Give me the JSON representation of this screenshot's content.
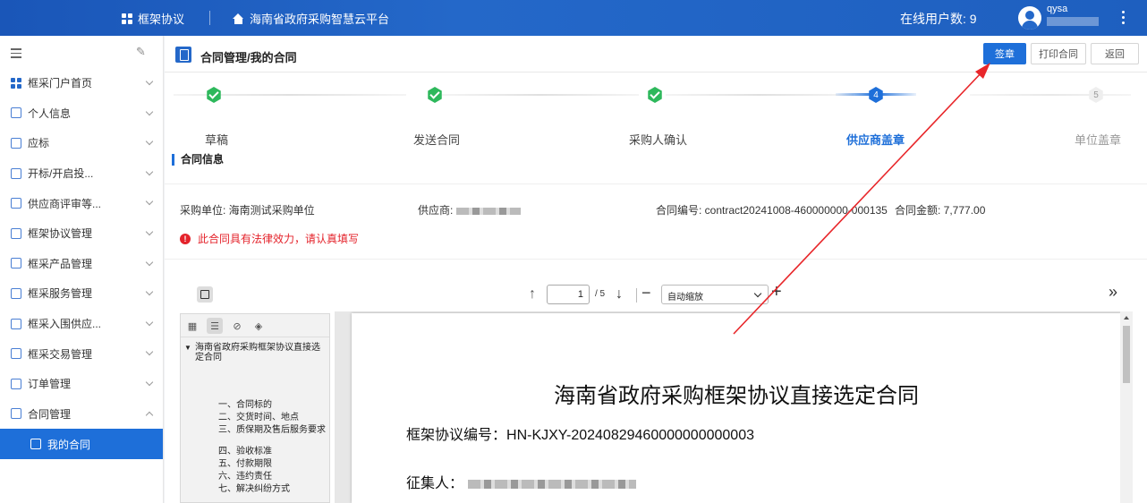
{
  "topbar": {
    "menu_label": "框架协议",
    "platform_name": "海南省政府采购智慧云平台",
    "online_users": "在线用户数: 9",
    "username": "qysa"
  },
  "sidebar": {
    "items": [
      {
        "label": "框采门户首页",
        "icon": "dots-grid-icon"
      },
      {
        "label": "个人信息",
        "icon": "id-card-icon"
      },
      {
        "label": "应标",
        "icon": "form-icon"
      },
      {
        "label": "开标/开启投...",
        "icon": "form-icon"
      },
      {
        "label": "供应商评审等...",
        "icon": "monitor-icon"
      },
      {
        "label": "框架协议管理",
        "icon": "agreement-icon"
      },
      {
        "label": "框采产品管理",
        "icon": "product-icon"
      },
      {
        "label": "框采服务管理",
        "icon": "service-icon"
      },
      {
        "label": "框采入围供应...",
        "icon": "supplier-icon"
      },
      {
        "label": "框采交易管理",
        "icon": "trade-icon"
      },
      {
        "label": "订单管理",
        "icon": "order-icon"
      },
      {
        "label": "合同管理",
        "icon": "contract-icon"
      }
    ],
    "active_item": {
      "label": "我的合同",
      "icon": "contract-icon"
    }
  },
  "breadcrumb": "合同管理/我的合同",
  "buttons": {
    "sign": "签章",
    "print": "打印合同",
    "back": "返回"
  },
  "steps": [
    {
      "label": "草稿",
      "status": "done"
    },
    {
      "label": "发送合同",
      "status": "done"
    },
    {
      "label": "采购人确认",
      "status": "done"
    },
    {
      "label": "供应商盖章",
      "status": "current",
      "number": "4"
    },
    {
      "label": "单位盖章",
      "status": "pending",
      "number": "5"
    }
  ],
  "section_title": "合同信息",
  "info": {
    "purchaser": "采购单位: 海南测试采购单位",
    "supplier_label": "供应商:",
    "contract_no": "合同编号: contract20241008-460000000-000135",
    "amount": "合同金额: 7,777.00",
    "warning": "此合同具有法律效力，请认真填写"
  },
  "pdf": {
    "page_current": "1",
    "page_total": "/ 5",
    "zoom": "自动缩放",
    "outline_root": "海南省政府采购框架协议直接选定合同",
    "outline_items": [
      "一、合同标的",
      "二、交货时间、地点",
      "三、质保期及售后服务要求",
      "四、验收标准",
      "五、付款期限",
      "六、违约责任",
      "七、解决纠纷方式"
    ],
    "doc_title": "海南省政府采购框架协议直接选定合同",
    "agreement_no_label": "框架协议编号：",
    "agreement_no": "HN-KJXY-20240829460000000000003",
    "collector_label": "征集人："
  },
  "colors": {
    "primary": "#1e6fd9",
    "success": "#2eb85c",
    "danger": "#e4232b",
    "annotation": "#e8262a"
  }
}
